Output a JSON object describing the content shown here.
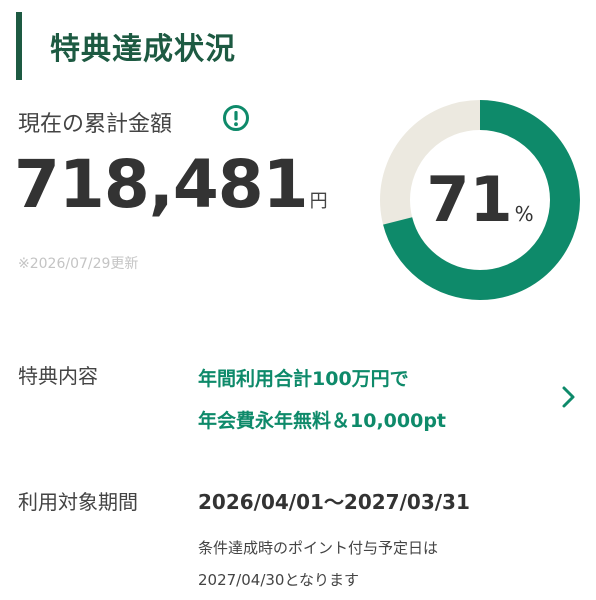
{
  "header": {
    "title": "特典達成状況"
  },
  "summary": {
    "total_label": "現在の累計金額",
    "amount": "718,481",
    "amount_unit": "円",
    "updated_note": "※2026/07/29更新",
    "info_icon": "exclamation-circle-icon"
  },
  "progress": {
    "percent": 71,
    "percent_text": "71",
    "unit": "%",
    "fill_color": "#0e8a6a",
    "track_color": "#ece9e0"
  },
  "benefit": {
    "label": "特典内容",
    "lines": [
      "年間利用合計100万円で",
      "年会費永年無料＆10,000pt"
    ],
    "chevron_icon": "chevron-right-icon"
  },
  "period": {
    "label": "利用対象期間",
    "value": "2026/04/01〜2027/03/31",
    "notes": [
      "条件達成時のポイント付与予定日は",
      "2027/04/30となります"
    ]
  },
  "colors": {
    "accent_dark": "#1d5a42",
    "accent_green": "#0e8a6a",
    "text": "#333333",
    "muted": "#c4c4c4"
  }
}
